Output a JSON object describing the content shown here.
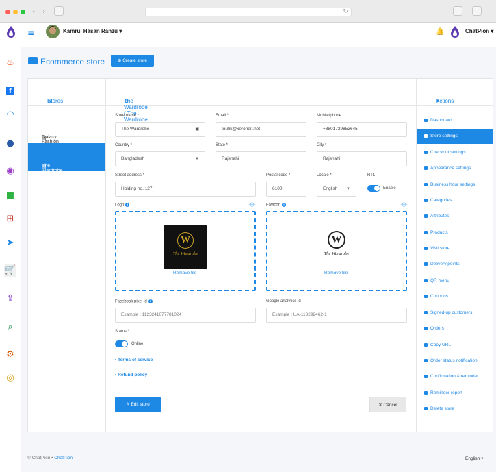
{
  "header": {
    "user_name": "Kamrul Hasan Ranzu",
    "brand": "ChatPion"
  },
  "page": {
    "title": "Ecommerce store",
    "create_button": "Create store"
  },
  "stores": {
    "heading": "Stores",
    "items": [
      {
        "label": "Galaxy Fashion",
        "active": false
      },
      {
        "label": "The Wardrobe",
        "active": true
      }
    ]
  },
  "form": {
    "heading": "The Wardrobe ( The Wardrobe ) : Store settings",
    "store_name": {
      "label": "Store name *",
      "value": "The Wardrobe"
    },
    "email": {
      "label": "Email *",
      "value": "toufik@xeroneit.net"
    },
    "mobile": {
      "label": "Mobile/phone",
      "value": "+8801729853645"
    },
    "country": {
      "label": "Country *",
      "value": "Bangladesh"
    },
    "state": {
      "label": "State *",
      "value": "Rajshahi"
    },
    "city": {
      "label": "City *",
      "value": "Rajshahi"
    },
    "street": {
      "label": "Street address *",
      "value": "Holding no. 127"
    },
    "postal": {
      "label": "Postal code *",
      "value": "6100"
    },
    "locale": {
      "label": "Locale *",
      "value": "English"
    },
    "rtl": {
      "label": "RTL",
      "toggle_label": "Enable",
      "enabled": true
    },
    "logo": {
      "label": "Logo",
      "remove": "Remove file",
      "image_text": "The Wardrobe",
      "image_letter": "W"
    },
    "favicon": {
      "label": "Favicon",
      "remove": "Remove file",
      "image_text": "The Wardrobe",
      "image_letter": "W"
    },
    "fb_pixel": {
      "label": "Facebook pixel id",
      "placeholder": "Example : 1123241077781024"
    },
    "ga_id": {
      "label": "Google analytics id",
      "placeholder": "Example : UA-118292462-1"
    },
    "status": {
      "label": "Status *",
      "toggle_label": "Online",
      "enabled": true
    },
    "terms_link": "Terms of service",
    "refund_link": "Refund policy",
    "edit_button": "Edit store",
    "cancel_button": "Cancel"
  },
  "actions": {
    "heading": "Actions",
    "items": [
      {
        "label": "Dashboard",
        "active": false
      },
      {
        "label": "Store settings",
        "active": true
      },
      {
        "label": "Checkout settings",
        "active": false
      },
      {
        "label": "Appearance settings",
        "active": false
      },
      {
        "label": "Business hour settings",
        "active": false
      },
      {
        "label": "Categories",
        "active": false
      },
      {
        "label": "Attributes",
        "active": false
      },
      {
        "label": "Products",
        "active": false
      },
      {
        "label": "Visit store",
        "active": false
      },
      {
        "label": "Delivery points",
        "active": false
      },
      {
        "label": "QR menu",
        "active": false
      },
      {
        "label": "Coupons",
        "active": false
      },
      {
        "label": "Signed-up customers",
        "active": false
      },
      {
        "label": "Orders",
        "active": false
      },
      {
        "label": "Copy URL",
        "active": false
      },
      {
        "label": "Order status notification",
        "active": false
      },
      {
        "label": "Confirmation & reminder",
        "active": false
      },
      {
        "label": "Reminder report",
        "active": false
      },
      {
        "label": "Delete store",
        "active": false
      }
    ]
  },
  "footer": {
    "copyright": "© ChatPion",
    "separator": "•",
    "brand_link": "ChatPion",
    "language": "English"
  },
  "sidebar_icons": [
    "fire-icon",
    "facebook-icon",
    "wifi-icon",
    "chat-icon",
    "user-icon",
    "message-icon",
    "flow-icon",
    "send-icon",
    "cart-icon",
    "share-icon",
    "search-icon",
    "gear-icon",
    "coins-icon"
  ],
  "colors": {
    "accent": "#1e88e5",
    "background": "#f4f6f9"
  }
}
